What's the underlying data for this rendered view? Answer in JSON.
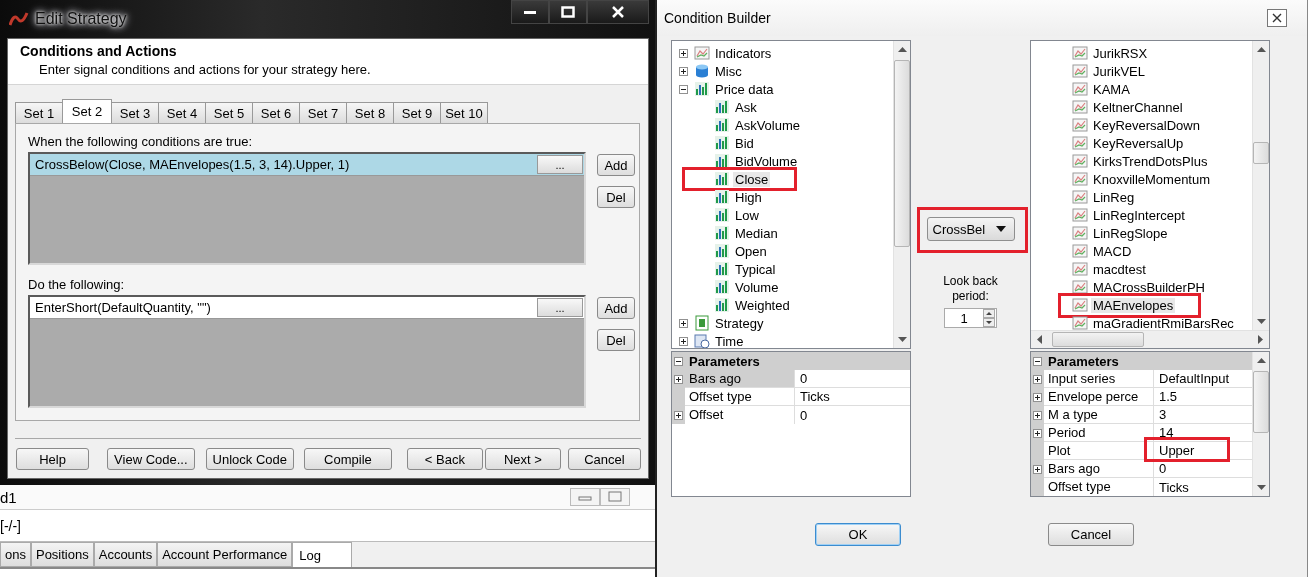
{
  "edit_strategy": {
    "title": "Edit Strategy",
    "header": {
      "title": "Conditions and Actions",
      "subtitle": "Enter signal conditions and actions for your strategy here."
    },
    "tabs": [
      {
        "label": "Set 1",
        "selected": false
      },
      {
        "label": "Set 2",
        "selected": true
      },
      {
        "label": "Set 3",
        "selected": false
      },
      {
        "label": "Set 4",
        "selected": false
      },
      {
        "label": "Set 5",
        "selected": false
      },
      {
        "label": "Set 6",
        "selected": false
      },
      {
        "label": "Set 7",
        "selected": false
      },
      {
        "label": "Set 8",
        "selected": false
      },
      {
        "label": "Set 9",
        "selected": false
      },
      {
        "label": "Set 10",
        "selected": false
      }
    ],
    "sections": [
      {
        "label": "When the following conditions are true:",
        "rows": [
          {
            "text": "CrossBelow(Close, MAEnvelopes(1.5, 3, 14).Upper, 1)",
            "button": "...",
            "selected": true
          }
        ],
        "buttons": [
          "Add",
          "Del"
        ]
      },
      {
        "label": "Do the following:",
        "rows": [
          {
            "text": "EnterShort(DefaultQuantity, \"\")",
            "button": "...",
            "selected": false
          }
        ],
        "buttons": [
          "Add",
          "Del"
        ]
      }
    ],
    "buttons": [
      "Help",
      "View Code...",
      "Unlock Code",
      "Compile",
      "< Back",
      "Next >",
      "Cancel"
    ]
  },
  "background_app": {
    "window_label": "d1",
    "status": "[-/-]",
    "tabs": [
      {
        "label": "ons",
        "selected": false
      },
      {
        "label": "Positions",
        "selected": false
      },
      {
        "label": "Accounts",
        "selected": false
      },
      {
        "label": "Account Performance",
        "selected": false
      },
      {
        "label": "Log",
        "selected": true
      }
    ]
  },
  "condition_builder": {
    "title": "Condition Builder",
    "left_tree": [
      {
        "label": "Indicators",
        "kind": "indicator",
        "expanded": false
      },
      {
        "label": "Misc",
        "kind": "misc",
        "expanded": false
      },
      {
        "label": "Price data",
        "kind": "price",
        "expanded": true,
        "children": [
          {
            "label": "Ask",
            "kind": "price",
            "selected": false,
            "highlighted": false
          },
          {
            "label": "AskVolume",
            "kind": "price",
            "selected": false,
            "highlighted": false
          },
          {
            "label": "Bid",
            "kind": "price",
            "selected": false,
            "highlighted": false
          },
          {
            "label": "BidVolume",
            "kind": "price",
            "selected": false,
            "highlighted": false
          },
          {
            "label": "Close",
            "kind": "price",
            "selected": true,
            "highlighted": true
          },
          {
            "label": "High",
            "kind": "price",
            "selected": false,
            "highlighted": false
          },
          {
            "label": "Low",
            "kind": "price",
            "selected": false,
            "highlighted": false
          },
          {
            "label": "Median",
            "kind": "price",
            "selected": false,
            "highlighted": false
          },
          {
            "label": "Open",
            "kind": "price",
            "selected": false,
            "highlighted": false
          },
          {
            "label": "Typical",
            "kind": "price",
            "selected": false,
            "highlighted": false
          },
          {
            "label": "Volume",
            "kind": "price",
            "selected": false,
            "highlighted": false
          },
          {
            "label": "Weighted",
            "kind": "price",
            "selected": false,
            "highlighted": false
          }
        ]
      },
      {
        "label": "Strategy",
        "kind": "strategy",
        "expanded": false
      },
      {
        "label": "Time",
        "kind": "time",
        "expanded": false
      }
    ],
    "left_parameters": {
      "title": "Parameters",
      "rows": [
        {
          "name": "Bars ago",
          "value": "0",
          "expandable": true,
          "selected": true,
          "highlighted": false
        },
        {
          "name": "Offset type",
          "value": "Ticks",
          "expandable": false,
          "selected": false,
          "highlighted": false
        },
        {
          "name": "Offset",
          "value": "0",
          "expandable": true,
          "selected": false,
          "highlighted": false
        }
      ]
    },
    "operator": {
      "value": "CrossBel",
      "highlighted": true
    },
    "look_back": {
      "label": "Look back period:",
      "value": "1"
    },
    "right_tree": [
      {
        "label": "JurikRSX",
        "kind": "indicator",
        "selected": false,
        "highlighted": false
      },
      {
        "label": "JurikVEL",
        "kind": "indicator",
        "selected": false,
        "highlighted": false
      },
      {
        "label": "KAMA",
        "kind": "indicator",
        "selected": false,
        "highlighted": false
      },
      {
        "label": "KeltnerChannel",
        "kind": "indicator",
        "selected": false,
        "highlighted": false
      },
      {
        "label": "KeyReversalDown",
        "kind": "indicator",
        "selected": false,
        "highlighted": false
      },
      {
        "label": "KeyReversalUp",
        "kind": "indicator",
        "selected": false,
        "highlighted": false
      },
      {
        "label": "KirksTrendDotsPlus",
        "kind": "indicator",
        "selected": false,
        "highlighted": false
      },
      {
        "label": "KnoxvilleMomentum",
        "kind": "indicator",
        "selected": false,
        "highlighted": false
      },
      {
        "label": "LinReg",
        "kind": "indicator",
        "selected": false,
        "highlighted": false
      },
      {
        "label": "LinRegIntercept",
        "kind": "indicator",
        "selected": false,
        "highlighted": false
      },
      {
        "label": "LinRegSlope",
        "kind": "indicator",
        "selected": false,
        "highlighted": false
      },
      {
        "label": "MACD",
        "kind": "indicator",
        "selected": false,
        "highlighted": false
      },
      {
        "label": "macdtest",
        "kind": "indicator",
        "selected": false,
        "highlighted": false
      },
      {
        "label": "MACrossBuilderPH",
        "kind": "indicator",
        "selected": false,
        "highlighted": false
      },
      {
        "label": "MAEnvelopes",
        "kind": "indicator",
        "selected": true,
        "highlighted": true
      },
      {
        "label": "maGradientRmiBarsRec",
        "kind": "indicator",
        "selected": false,
        "highlighted": false
      }
    ],
    "right_parameters": {
      "title": "Parameters",
      "rows": [
        {
          "name": "Input series",
          "value": "DefaultInput",
          "expandable": true,
          "selected": false,
          "highlighted": false
        },
        {
          "name": "Envelope perce",
          "value": "1.5",
          "expandable": true,
          "selected": false,
          "highlighted": false
        },
        {
          "name": "M a type",
          "value": "3",
          "expandable": true,
          "selected": false,
          "highlighted": false
        },
        {
          "name": "Period",
          "value": "14",
          "expandable": true,
          "selected": false,
          "highlighted": false
        },
        {
          "name": "Plot",
          "value": "Upper",
          "expandable": false,
          "selected": false,
          "highlighted": true
        },
        {
          "name": "Bars ago",
          "value": "0",
          "expandable": true,
          "selected": false,
          "highlighted": false
        },
        {
          "name": "Offset type",
          "value": "Ticks",
          "expandable": false,
          "selected": false,
          "highlighted": false
        }
      ]
    },
    "buttons": [
      "OK",
      "Cancel"
    ]
  }
}
